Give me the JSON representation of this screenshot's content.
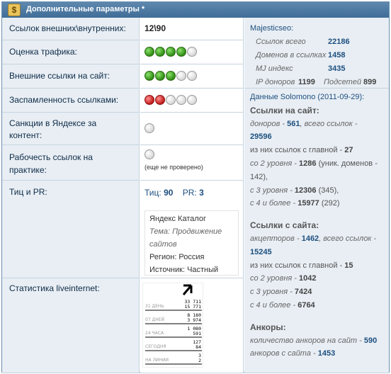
{
  "header": {
    "logo_glyph": "$",
    "title": "Дополнительные параметры *"
  },
  "rows": {
    "links": {
      "label": "Ссылок внешних\\внутренних:",
      "value": "12\\90"
    },
    "traffic": {
      "label": "Оценка трафика:",
      "level": 4,
      "max": 5,
      "color": "green"
    },
    "external": {
      "label": "Внешние ссылки на сайт:",
      "level": 3,
      "max": 5,
      "color": "green"
    },
    "spam": {
      "label": "Заспамленность ссылками:",
      "level": 2,
      "max": 5,
      "color": "red"
    },
    "sanctions": {
      "label_line1": "Санкции в Яндексе за",
      "label_line2": "контент:"
    },
    "working": {
      "label_line1": "Рабочесть ссылок на",
      "label_line2": "практике:",
      "note": "(еще не проверено)"
    },
    "tic": {
      "label": "Тиц и PR:",
      "tic_label": "Тиц:",
      "tic": "90",
      "pr_label": "PR:",
      "pr": "3"
    },
    "stats": {
      "label": "Статистика liveinternet:"
    }
  },
  "yandex_catalog": {
    "title": "Яндекс Каталог",
    "theme": "Тема: Продвижение сайтов",
    "region": "Регион: Россия",
    "source": "Источник: Частный"
  },
  "liveinternet": {
    "rows": [
      {
        "label": "31 ДЕНЬ",
        "a": "33 711",
        "b": "15 771"
      },
      {
        "label": "07 ДНЕЙ",
        "a": "8 180",
        "b": "3 974"
      },
      {
        "label": "24 ЧАСА",
        "a": "1 080",
        "b": "591"
      },
      {
        "label": "СЕГОДНЯ",
        "a": "127",
        "b": "84"
      },
      {
        "label": "НА ЛИНИИ",
        "a": "3",
        "b": "2"
      }
    ]
  },
  "majestic": {
    "title": "Majesticseo:",
    "links_total_label": "Ссылок всего",
    "links_total": "22186",
    "domains_label": "Доменов в ссылках",
    "domains": "1458",
    "mj_label": "MJ индекс",
    "mj": "3435",
    "ip_label": "IP доноров",
    "ip": "1199",
    "subnets_label": "Подсетей",
    "subnets": "899"
  },
  "solomono": {
    "title": "Данные Solomono (2011-09-29):",
    "in_title": "Ссылки на сайт:",
    "donors_label": "доноров -",
    "donors": "561",
    "total_label": ", всего ссылок -",
    "total": "29596",
    "main_label": "из них ссылок с главной -",
    "main": "27",
    "lvl2_label": "со 2 уровня -",
    "lvl2": "1286",
    "lvl2_extra": "(уник. доменов -",
    "lvl2_extra2": "142),",
    "lvl3_label": "с 3 уровня -",
    "lvl3": "12306",
    "lvl3_extra": "(345),",
    "lvl4_label": "с 4 и более -",
    "lvl4": "15977",
    "lvl4_extra": "(292)",
    "out_title": "Ссылки с сайта:",
    "acc_label": "акцепторов -",
    "acc": "1462",
    "out_total_label": ", всего ссылок -",
    "out_total": "15245",
    "out_main_label": "из них ссылок с главной -",
    "out_main": "15",
    "out_lvl2_label": "со 2 уровня -",
    "out_lvl2": "1042",
    "out_lvl3_label": "с 3 уровня -",
    "out_lvl3": "7424",
    "out_lvl4_label": "с 4 и более -",
    "out_lvl4": "6764",
    "anchors_title": "Анкоры:",
    "anchors_in_label": "количество анкоров на сайт -",
    "anchors_in": "590",
    "anchors_out_label": "анкоров с сайта -",
    "anchors_out": "1453"
  }
}
